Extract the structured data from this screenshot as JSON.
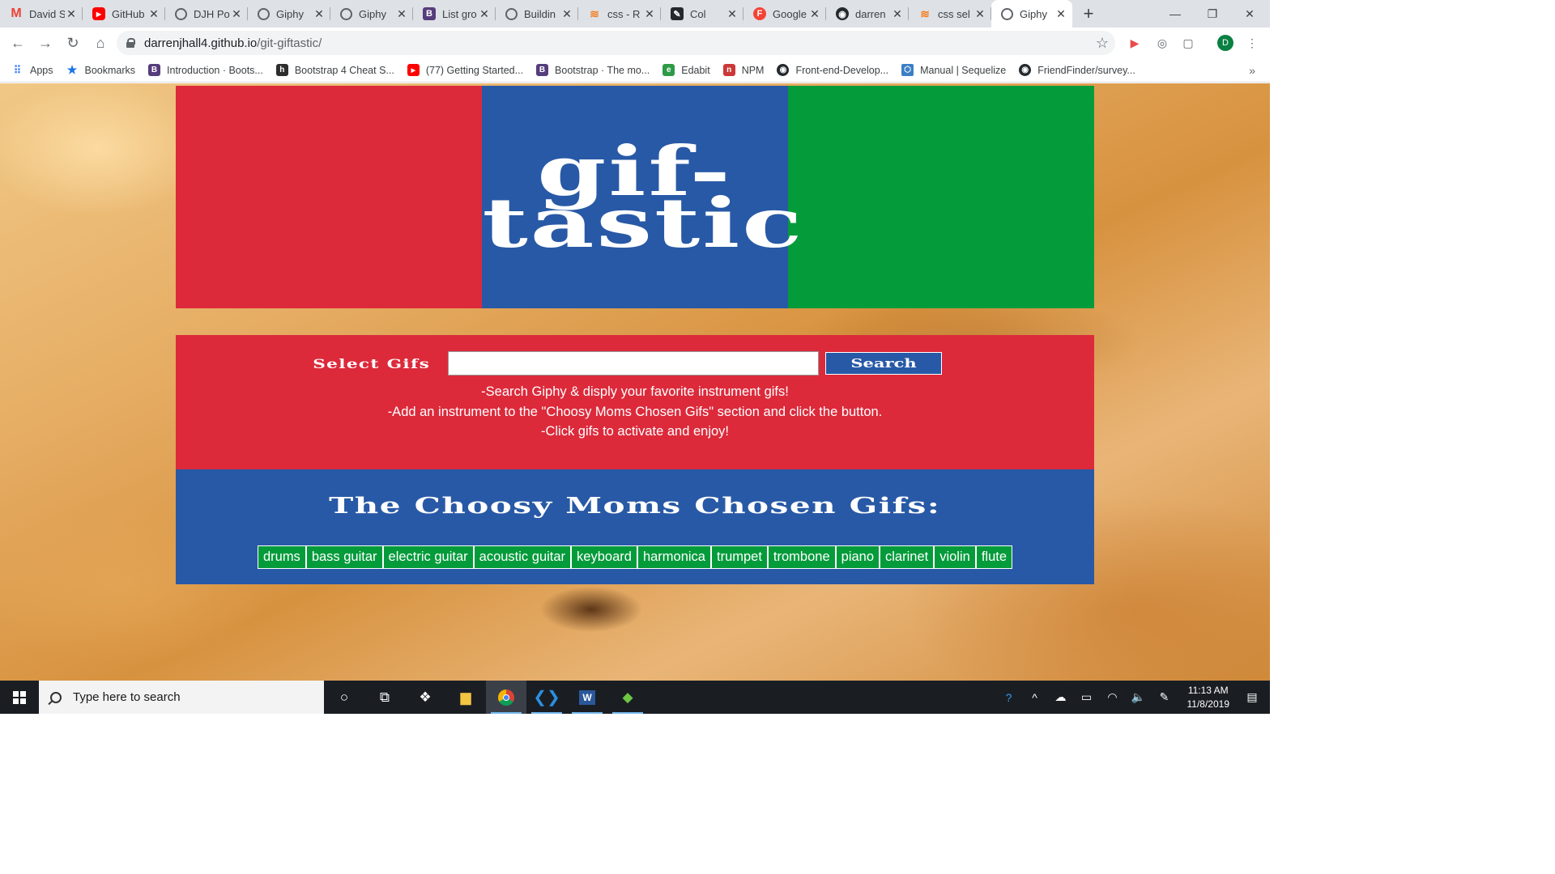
{
  "browser": {
    "tabs": [
      {
        "title": "David S",
        "icon": "gmail-icon"
      },
      {
        "title": "GitHub",
        "icon": "youtube-icon"
      },
      {
        "title": "DJH Po",
        "icon": "globe-icon"
      },
      {
        "title": "Giphy",
        "icon": "globe-icon"
      },
      {
        "title": "Giphy",
        "icon": "globe-icon"
      },
      {
        "title": "List gro",
        "icon": "bootstrap-icon"
      },
      {
        "title": "Buildin",
        "icon": "globe-icon"
      },
      {
        "title": "css - R",
        "icon": "stackoverflow-icon"
      },
      {
        "title": "Col",
        "icon": "codepen-icon"
      },
      {
        "title": "Google",
        "icon": "google-fonts-icon"
      },
      {
        "title": "darren",
        "icon": "github-icon"
      },
      {
        "title": "css sel",
        "icon": "stackoverflow-icon"
      },
      {
        "title": "Giphy",
        "icon": "globe-icon",
        "active": true
      }
    ],
    "url_host": "darrenjhall4.github.io",
    "url_path": "/git-giftastic/",
    "profile_initial": "D",
    "bookmarks": [
      {
        "label": "Apps",
        "icon": "apps-grid-icon"
      },
      {
        "label": "Bookmarks",
        "icon": "star-icon"
      },
      {
        "label": "Introduction · Boots...",
        "icon": "bootstrap-icon"
      },
      {
        "label": "Bootstrap 4 Cheat S...",
        "icon": "h-icon"
      },
      {
        "label": "(77) Getting Started...",
        "icon": "youtube-icon"
      },
      {
        "label": "Bootstrap · The mo...",
        "icon": "bootstrap-icon"
      },
      {
        "label": "Edabit",
        "icon": "edabit-icon"
      },
      {
        "label": "NPM",
        "icon": "npm-icon"
      },
      {
        "label": "Front-end-Develop...",
        "icon": "github-icon"
      },
      {
        "label": "Manual | Sequelize",
        "icon": "sequelize-icon"
      },
      {
        "label": "FriendFinder/survey...",
        "icon": "github-icon"
      }
    ]
  },
  "page": {
    "title": "gif-tastic",
    "search_label": "Select Gifs",
    "search_value": "",
    "search_button": "Search",
    "instructions": [
      "-Search Giphy & disply your favorite instrument gifs!",
      "-Add an instrument to the \"Choosy Moms Chosen Gifs\" section and click the button.",
      "-Click gifs to activate and enjoy!"
    ],
    "chosen_title": "The Choosy Moms Chosen Gifs:",
    "gif_buttons": [
      "drums",
      "bass guitar",
      "electric guitar",
      "acoustic guitar",
      "keyboard",
      "harmonica",
      "trumpet",
      "trombone",
      "piano",
      "clarinet",
      "violin",
      "flute"
    ],
    "colors": {
      "red": "#dc2a3b",
      "blue": "#2859a6",
      "green": "#049b3b"
    }
  },
  "taskbar": {
    "search_placeholder": "Type here to search",
    "time": "11:13 AM",
    "date": "11/8/2019",
    "apps": [
      "cortana-icon",
      "task-view-icon",
      "dropbox-icon",
      "file-explorer-icon",
      "chrome-icon",
      "vscode-icon",
      "word-icon",
      "git-kraken-icon"
    ]
  }
}
